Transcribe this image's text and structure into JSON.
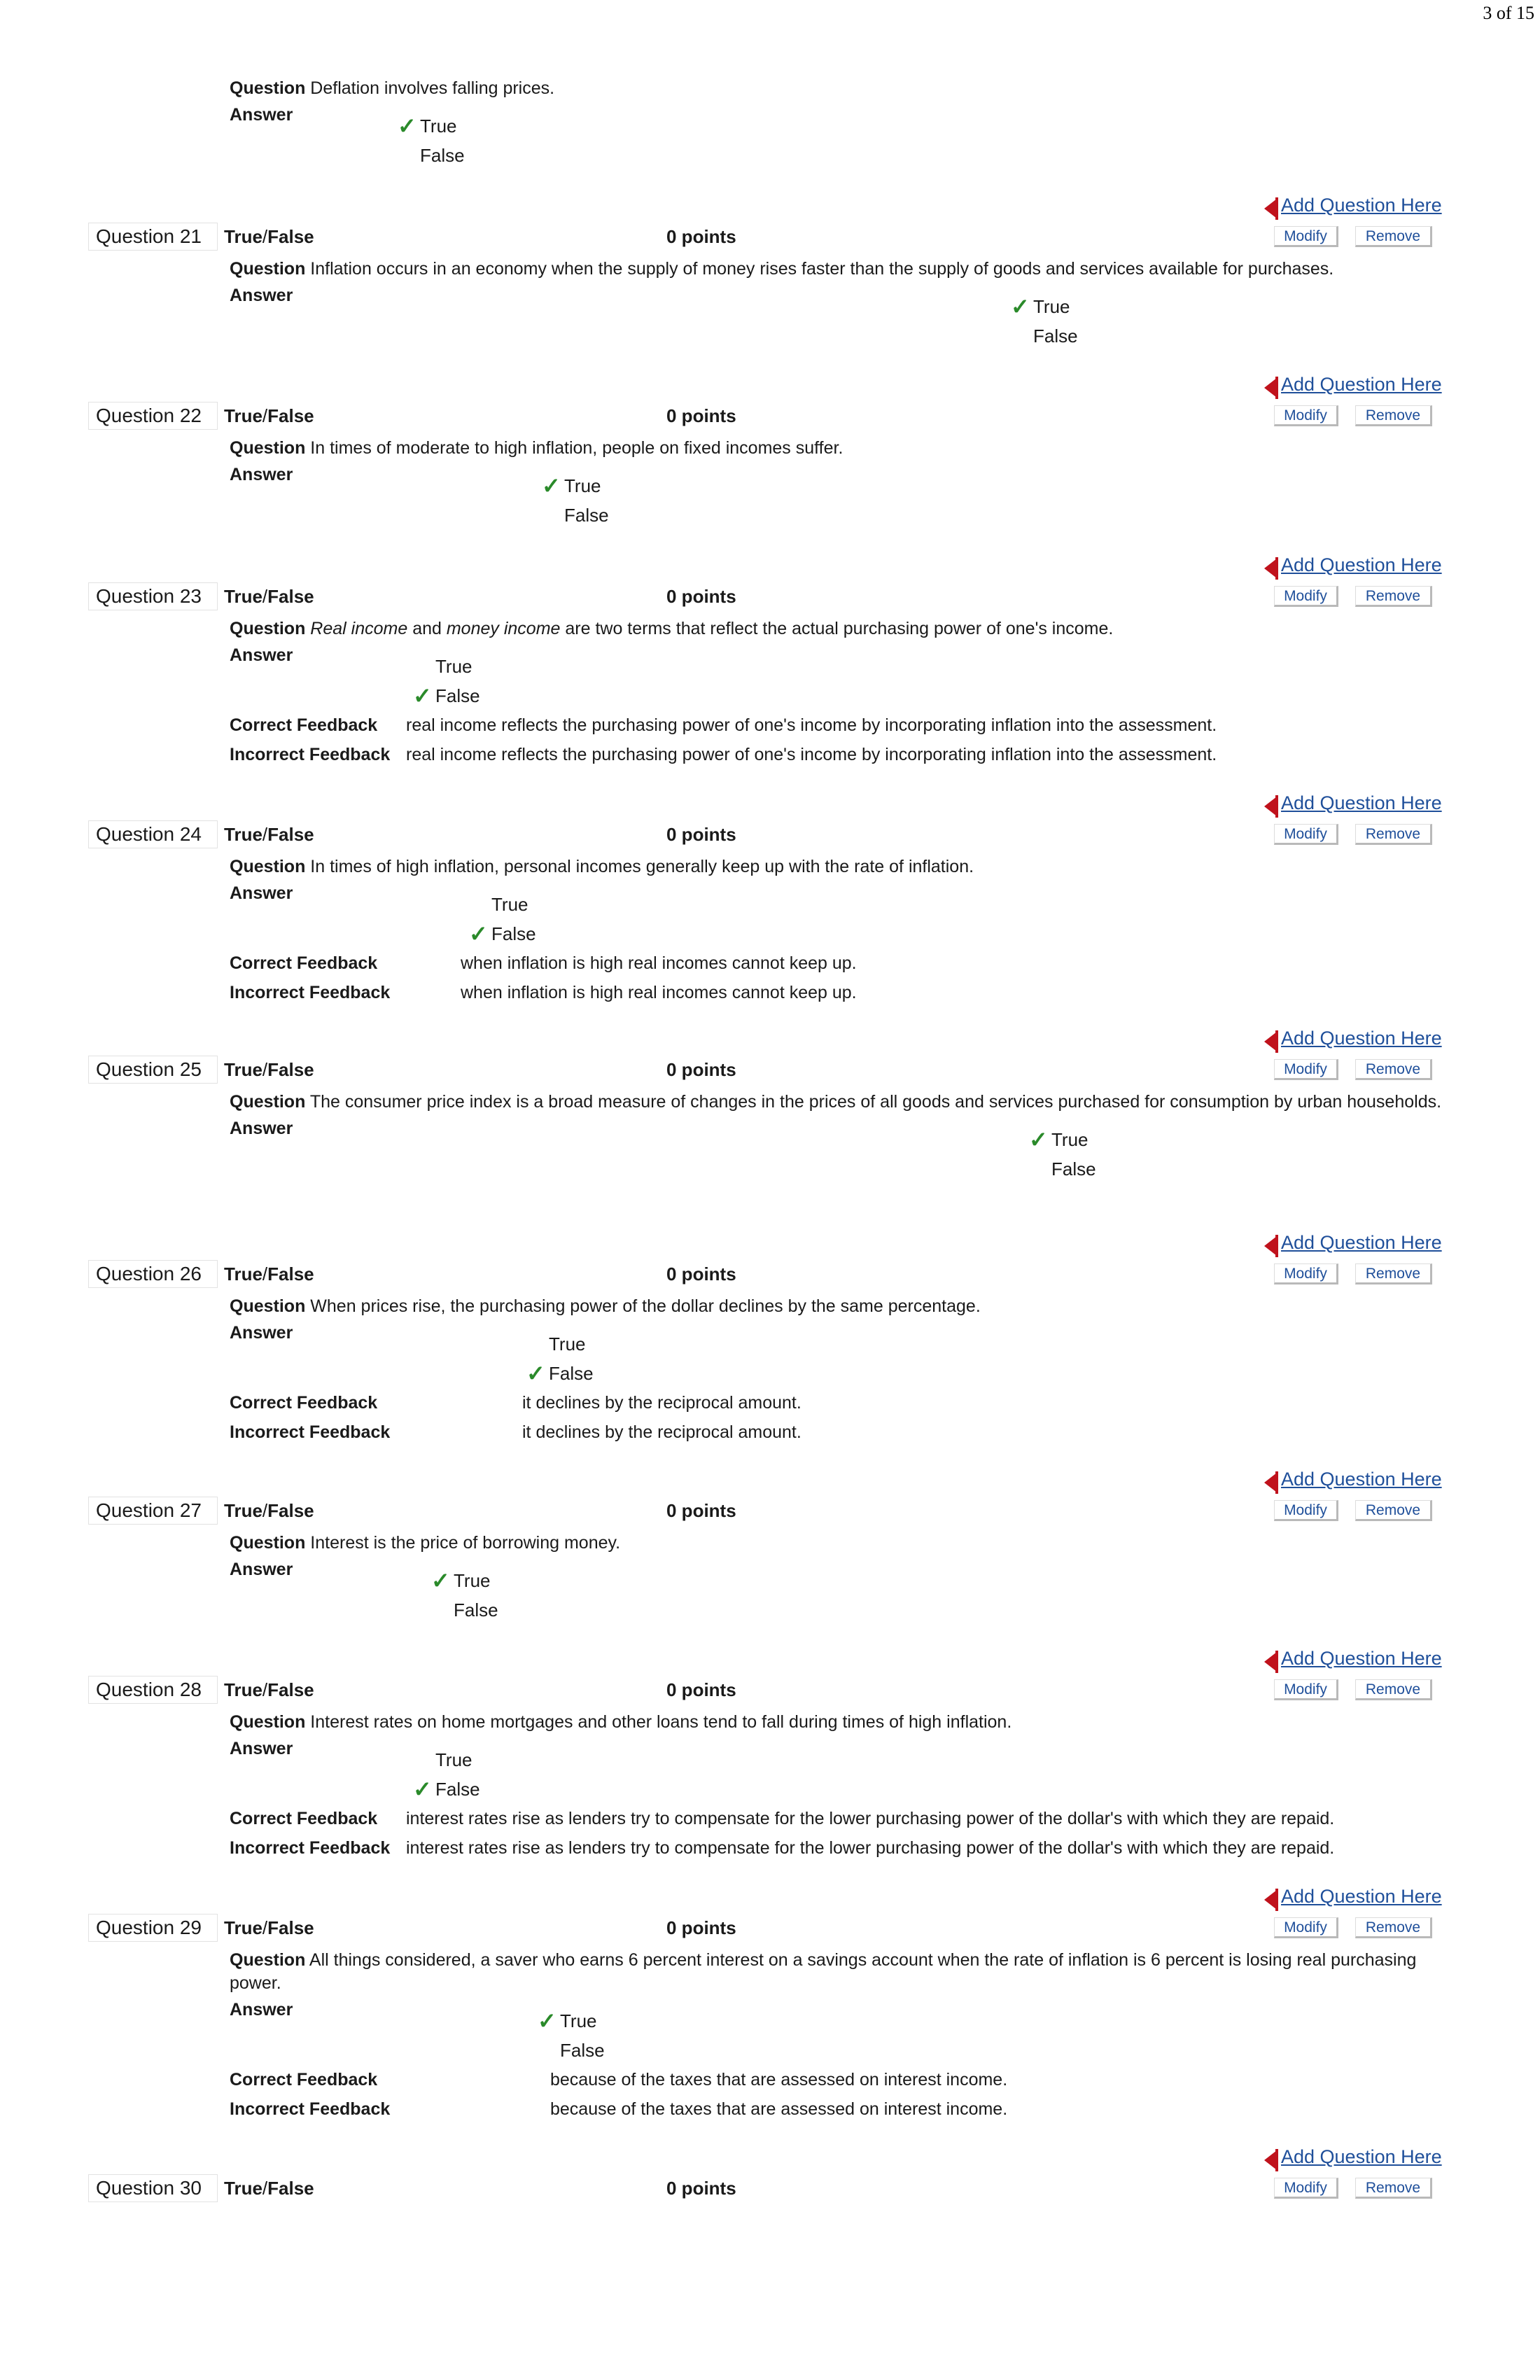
{
  "page_number": "3 of 15",
  "labels": {
    "question": "Question",
    "answer": "Answer",
    "correct_feedback": "Correct Feedback",
    "incorrect_feedback": "Incorrect Feedback",
    "add_question": "Add Question Here",
    "modify": "Modify",
    "remove": "Remove",
    "type_true": "True",
    "type_slash": "/",
    "type_false": "False",
    "points": "0 points",
    "checkmark": "✓"
  },
  "preceding_question": {
    "text": "Deflation involves falling prices.",
    "options": [
      "True",
      "False"
    ],
    "correct": 0
  },
  "questions": [
    {
      "number": "Question 21",
      "text": "Inflation occurs in an economy when the supply of money rises faster than the supply of goods and services available for purchases.",
      "options": [
        "True",
        "False"
      ],
      "correct": 0
    },
    {
      "number": "Question 22",
      "text": "In times of moderate to high inflation, people on fixed incomes suffer.",
      "options": [
        "True",
        "False"
      ],
      "correct": 0
    },
    {
      "number": "Question 23",
      "text_parts": [
        "Real income",
        " and ",
        "money income",
        " are two terms that reflect the actual purchasing power of one's income."
      ],
      "options": [
        "True",
        "False"
      ],
      "correct": 1,
      "correct_feedback": "real income reflects the purchasing power of one's income by incorporating inflation into the assessment.",
      "incorrect_feedback": "real income reflects the purchasing power of one's income by incorporating inflation into the assessment."
    },
    {
      "number": "Question 24",
      "text": "In times of high inflation, personal incomes generally keep up with the rate of inflation.",
      "options": [
        "True",
        "False"
      ],
      "correct": 1,
      "correct_feedback": "when inflation is high real incomes cannot keep up.",
      "incorrect_feedback": "when inflation is high real incomes cannot keep up."
    },
    {
      "number": "Question 25",
      "text": "The consumer price index is a broad measure of changes in the prices of all goods and services purchased for consumption by urban households.",
      "options": [
        "True",
        "False"
      ],
      "correct": 0
    },
    {
      "number": "Question 26",
      "text": "When prices rise, the purchasing power of the dollar declines by the same percentage.",
      "options": [
        "True",
        "False"
      ],
      "correct": 1,
      "correct_feedback": "it declines by the reciprocal amount.",
      "incorrect_feedback": "it declines by the reciprocal amount."
    },
    {
      "number": "Question 27",
      "text": "Interest is the price of borrowing money.",
      "options": [
        "True",
        "False"
      ],
      "correct": 0
    },
    {
      "number": "Question 28",
      "text": "Interest rates on home mortgages and other loans tend to fall during times of high inflation.",
      "options": [
        "True",
        "False"
      ],
      "correct": 1,
      "correct_feedback": "interest rates rise as lenders try to compensate for the lower purchasing power of the dollar's with which they are repaid.",
      "incorrect_feedback": "interest rates rise as lenders try to compensate for the lower purchasing power of the dollar's with which they are repaid."
    },
    {
      "number": "Question 29",
      "text": "All things considered, a saver who earns 6 percent interest on a savings account when the rate of inflation is 6 percent is losing real purchasing power.",
      "options": [
        "True",
        "False"
      ],
      "correct": 0,
      "correct_feedback": "because of the taxes that are assessed on interest income.",
      "incorrect_feedback": "because of the taxes that are assessed on interest income."
    },
    {
      "number": "Question 30"
    }
  ]
}
